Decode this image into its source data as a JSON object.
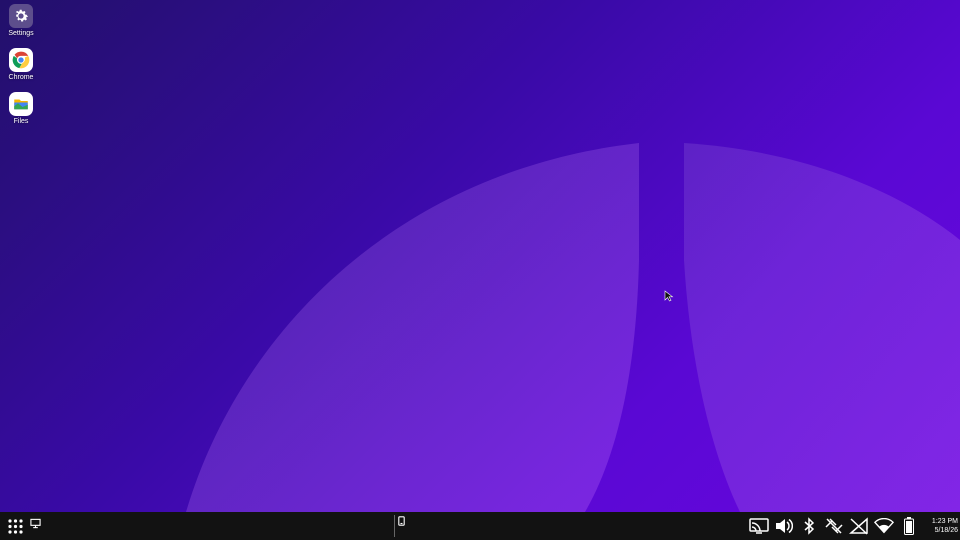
{
  "desktop": {
    "icons": [
      {
        "label": "Settings",
        "icon": "gear-icon"
      },
      {
        "label": "Chrome",
        "icon": "chrome-icon"
      },
      {
        "label": "Files",
        "icon": "folder-icon"
      }
    ]
  },
  "taskbar": {
    "launcher_icon": "app-grid-icon",
    "show_desktop_icon": "desktop-icon",
    "running_app_icon": "phone-icon",
    "tray": [
      "cast-screen-icon",
      "volume-icon",
      "bluetooth-icon",
      "data-sync-icon",
      "no-signal-icon",
      "wifi-icon",
      "battery-icon"
    ],
    "clock": {
      "time": "1:23 PM",
      "date": "5/18/26"
    }
  },
  "colors": {
    "wallpaper_dark": "#22106a",
    "wallpaper_light": "#6a06e0",
    "taskbar_bg": "#121212"
  }
}
